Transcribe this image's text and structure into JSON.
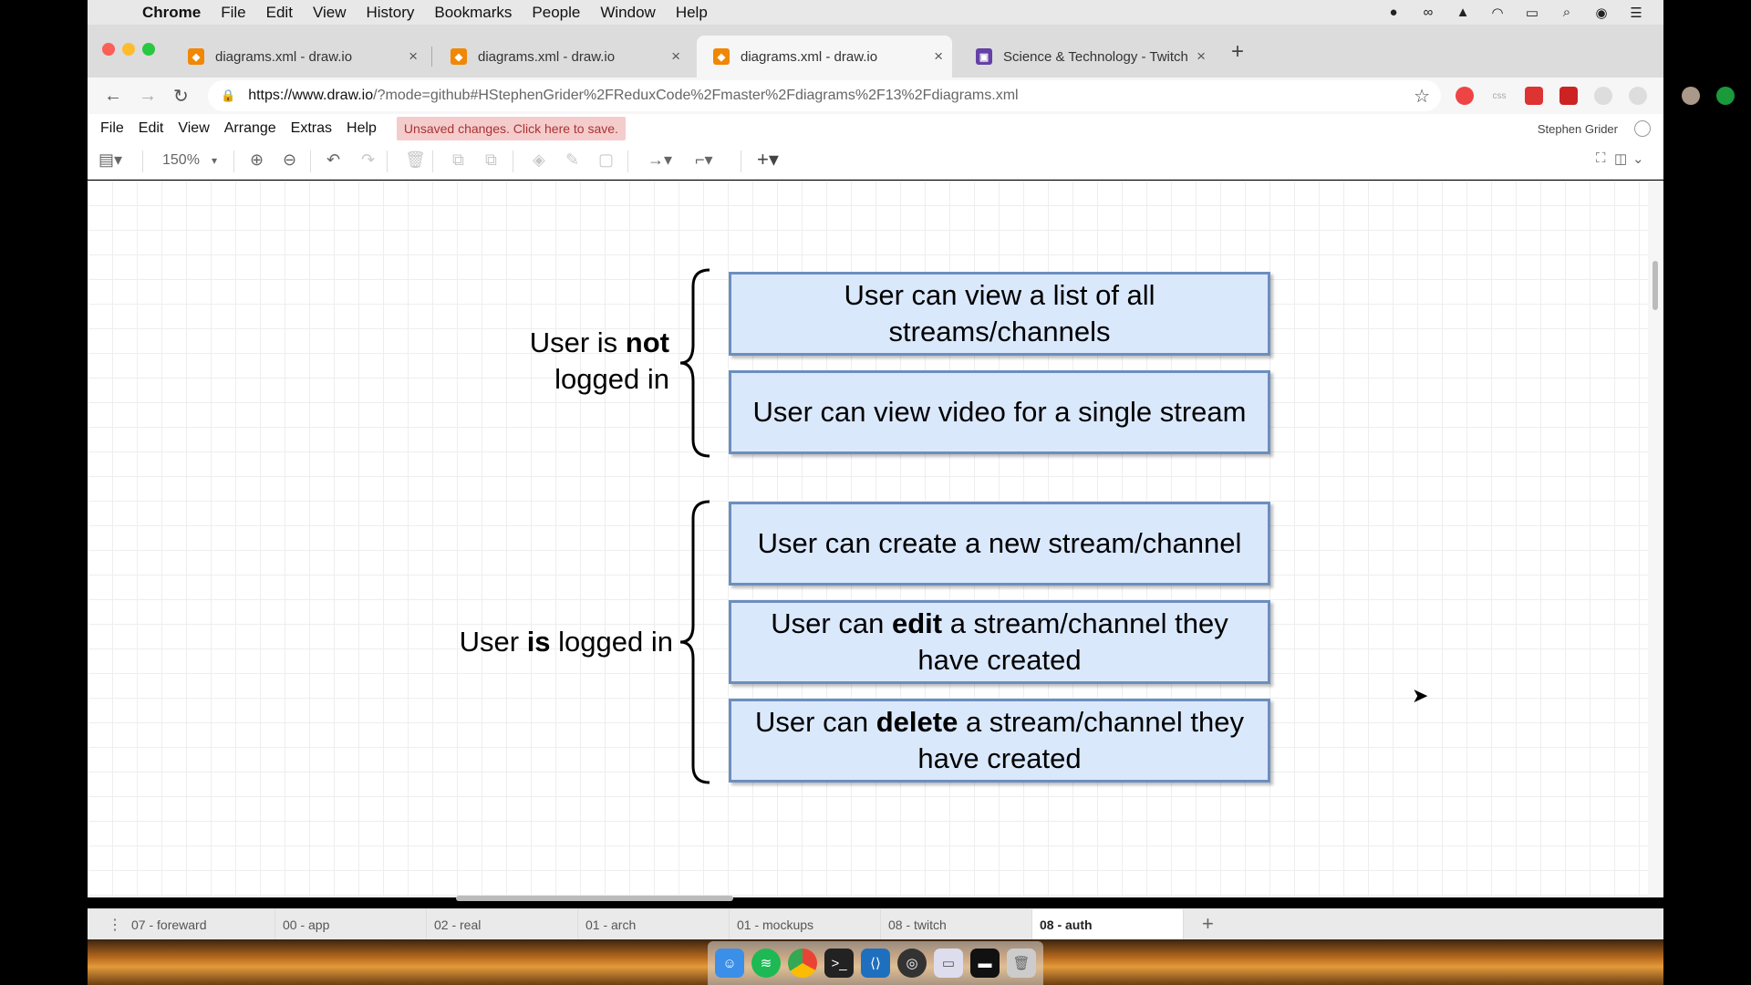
{
  "menubar": {
    "app_name": "Chrome",
    "items": [
      "File",
      "Edit",
      "View",
      "History",
      "Bookmarks",
      "People",
      "Window",
      "Help"
    ]
  },
  "browser": {
    "tabs": [
      {
        "title": "diagrams.xml - draw.io",
        "active": false,
        "icon": "drawio-icon"
      },
      {
        "title": "diagrams.xml - draw.io",
        "active": false,
        "icon": "drawio-icon"
      },
      {
        "title": "diagrams.xml - draw.io",
        "active": true,
        "icon": "drawio-icon"
      },
      {
        "title": "Science & Technology - Twitch",
        "active": false,
        "icon": "twitch-icon"
      }
    ],
    "url_host": "https://www.draw.io",
    "url_rest": "/?mode=github#HStephenGrider%2FReduxCode%2Fmaster%2Fdiagrams%2F13%2Fdiagrams.xml"
  },
  "drawio": {
    "menu": [
      "File",
      "Edit",
      "View",
      "Arrange",
      "Extras",
      "Help"
    ],
    "unsaved": "Unsaved changes. Click here to save.",
    "user": "Stephen Grider",
    "zoom": "150%"
  },
  "diagram": {
    "group1_label_pre": "User is ",
    "group1_label_bold": "not",
    "group1_label_post": "logged in",
    "group2_label_pre": "User ",
    "group2_label_bold": "is",
    "group2_label_post": " logged in",
    "box1": "User can view a list of all streams/channels",
    "box2": "User can view video for a single stream",
    "box3": "User can create a new stream/channel",
    "box4_pre": "User can ",
    "box4_bold": "edit",
    "box4_post": " a stream/channel they have created",
    "box5_pre": "User can ",
    "box5_bold": "delete",
    "box5_post": " a stream/channel they have created"
  },
  "pages": [
    {
      "label": "07 - foreward",
      "active": false
    },
    {
      "label": "00 - app",
      "active": false
    },
    {
      "label": "02 - real",
      "active": false
    },
    {
      "label": "01 - arch",
      "active": false
    },
    {
      "label": "01 - mockups",
      "active": false
    },
    {
      "label": "08 - twitch",
      "active": false
    },
    {
      "label": "08 - auth",
      "active": true
    }
  ],
  "colors": {
    "box_fill": "#dae8fc",
    "box_stroke": "#6c8ebf",
    "unsaved_bg": "#f4cccc"
  }
}
